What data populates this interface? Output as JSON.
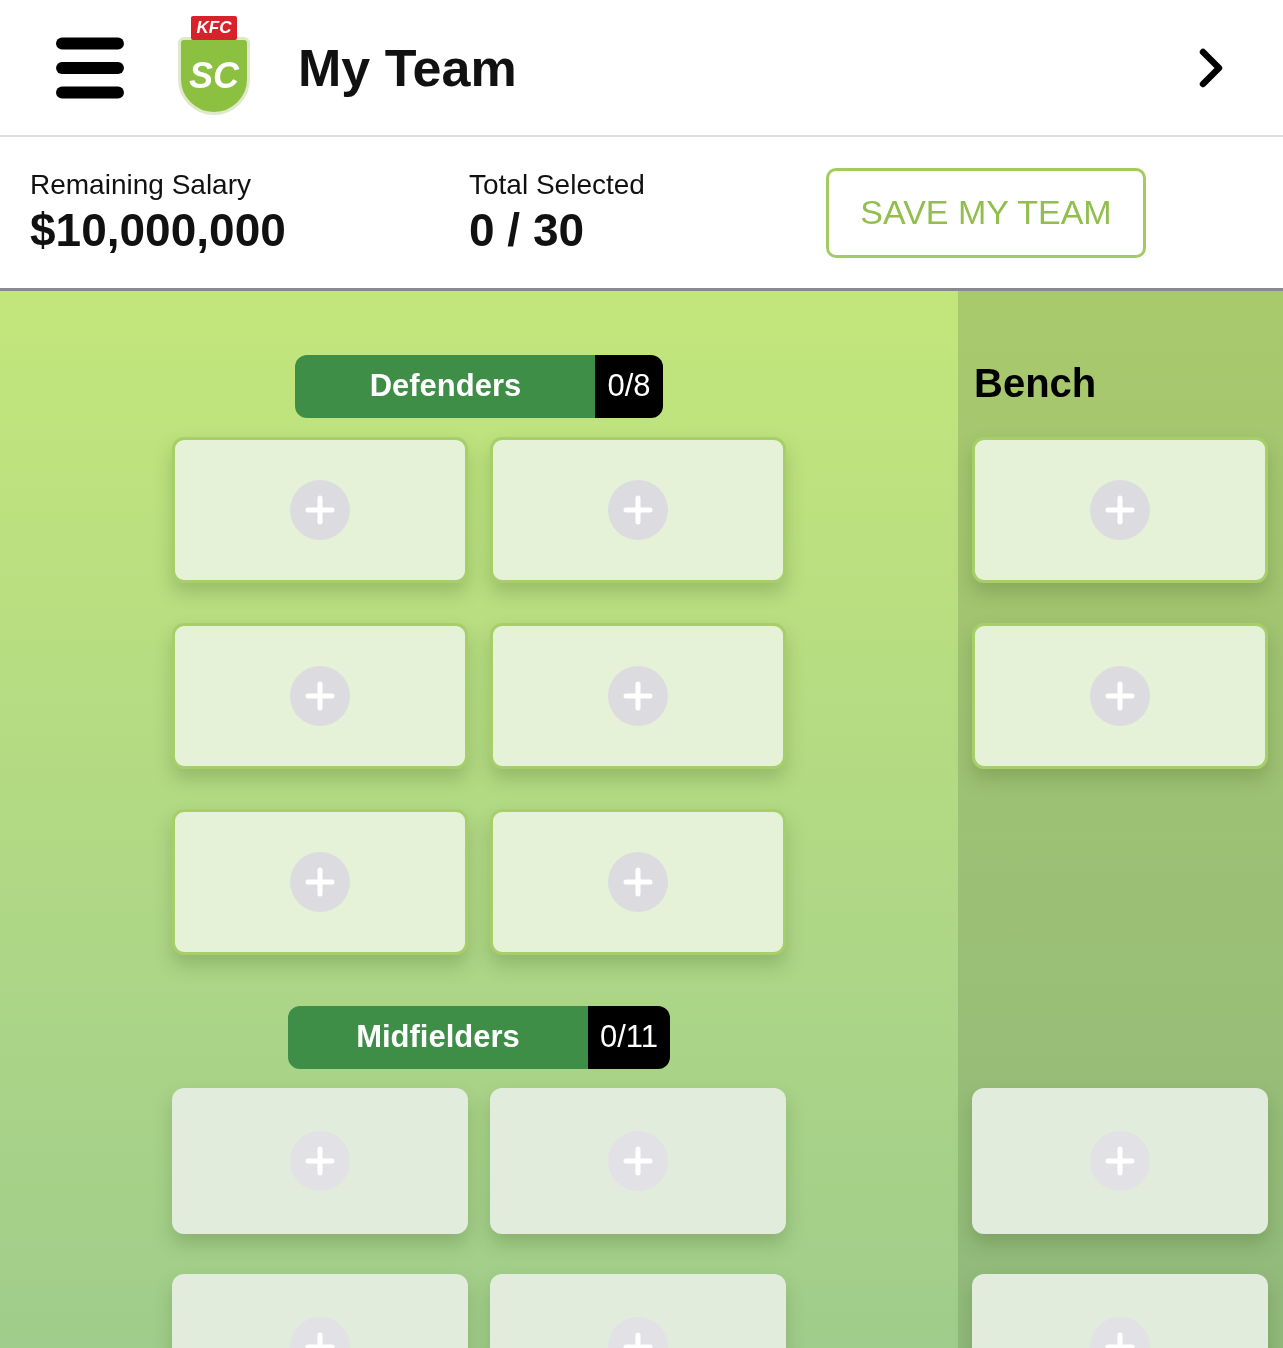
{
  "header": {
    "logo": {
      "badge": "KFC",
      "mark": "SC"
    },
    "title": "My Team"
  },
  "stats": [
    {
      "label": "Remaining Salary",
      "value": "$10,000,000"
    },
    {
      "label": "Total Selected",
      "value": "0 / 30"
    }
  ],
  "save_button": "SAVE MY TEAM",
  "sections": [
    {
      "title": "Defenders",
      "count": "0/8",
      "outlined": true,
      "slots": [
        {
          "kind": "empty"
        },
        {
          "kind": "empty"
        },
        {
          "kind": "empty"
        },
        {
          "kind": "empty"
        },
        {
          "kind": "empty"
        },
        {
          "kind": "empty"
        }
      ]
    },
    {
      "title": "Midfielders",
      "count": "0/11",
      "outlined": false,
      "slots": [
        {
          "kind": "empty"
        },
        {
          "kind": "empty"
        },
        {
          "kind": "empty"
        },
        {
          "kind": "empty"
        }
      ]
    }
  ],
  "bench": {
    "title": "Bench",
    "groups": [
      {
        "outlined": true,
        "slots": [
          {
            "kind": "empty"
          },
          {
            "kind": "empty"
          }
        ]
      },
      {
        "outlined": false,
        "slots": [
          {
            "kind": "empty"
          },
          {
            "kind": "empty"
          }
        ]
      }
    ]
  }
}
